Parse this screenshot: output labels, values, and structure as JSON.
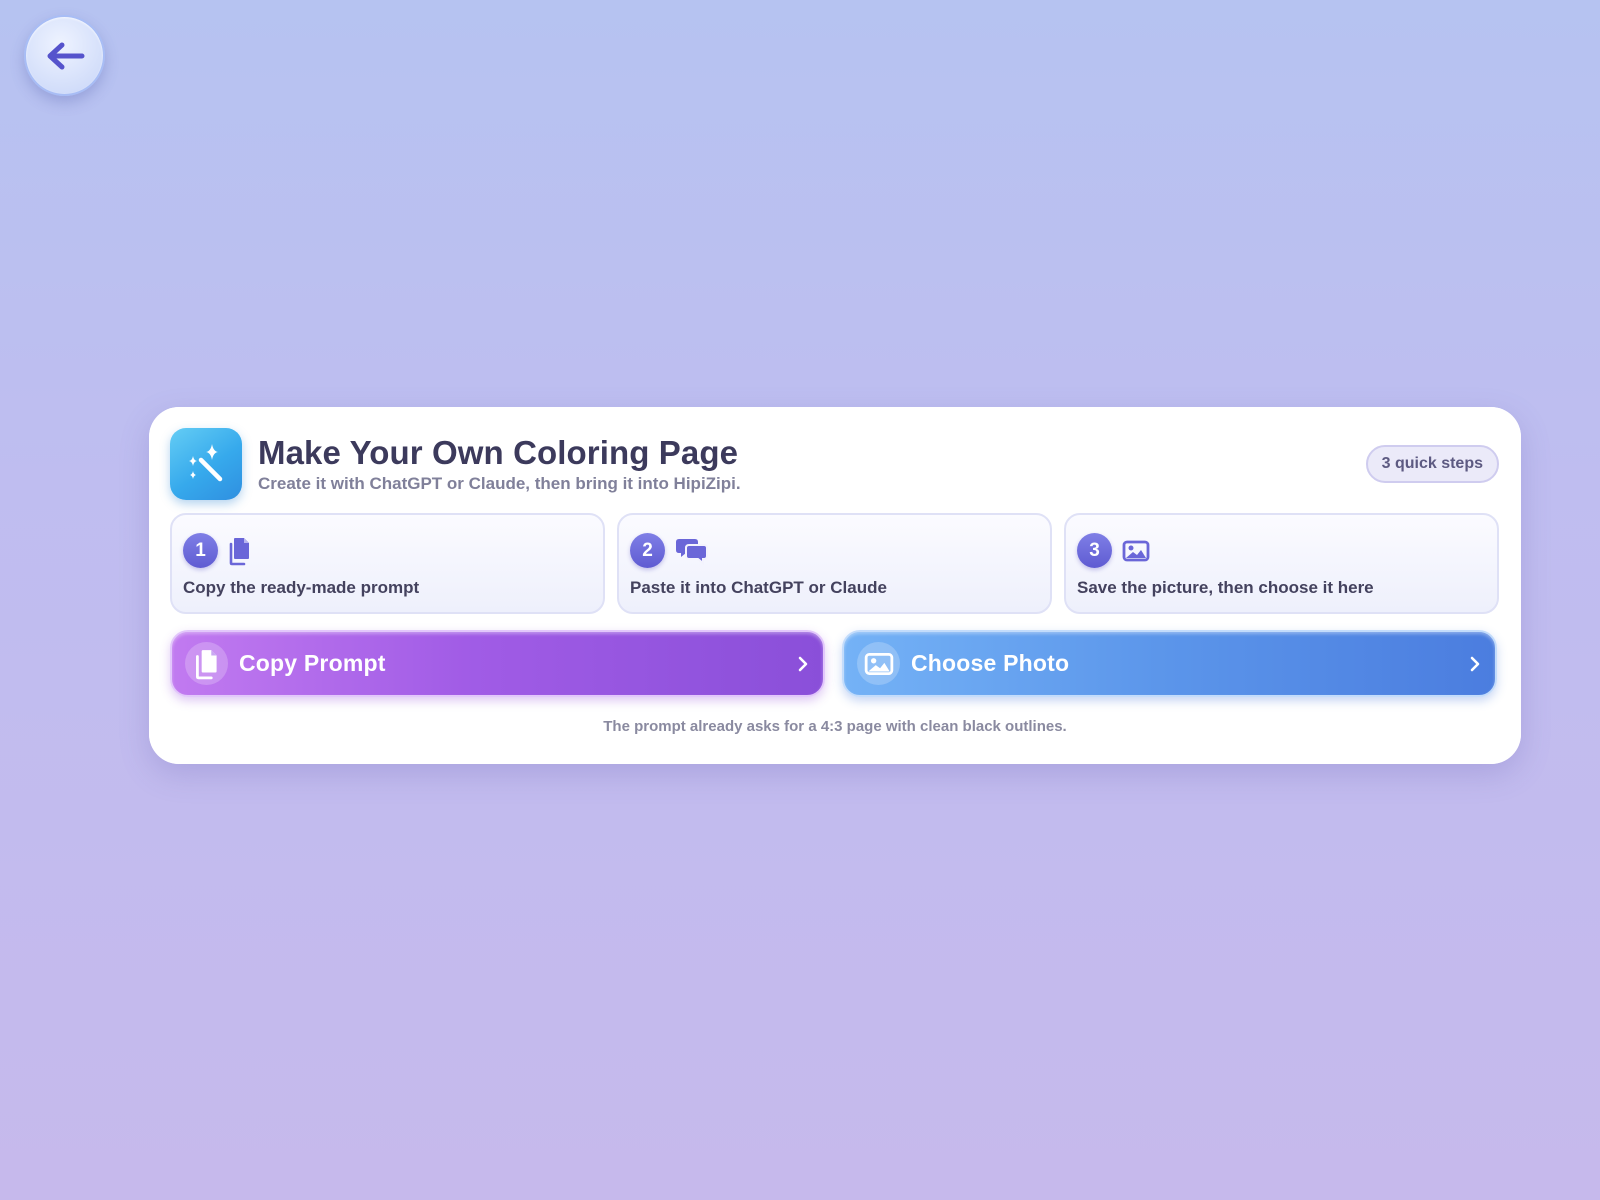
{
  "header": {
    "title": "Make Your Own Coloring Page",
    "subtitle": "Create it with ChatGPT or Claude, then bring it into HipiZipi.",
    "badge": "3 quick steps",
    "app_icon": "magic-wand-sparkles-icon"
  },
  "back_button": {
    "icon": "arrow-left-icon"
  },
  "steps": [
    {
      "number": "1",
      "icon": "copy-document-icon",
      "label": "Copy the ready-made prompt"
    },
    {
      "number": "2",
      "icon": "chat-bubbles-icon",
      "label": "Paste it into ChatGPT or Claude"
    },
    {
      "number": "3",
      "icon": "image-icon",
      "label": "Save the picture, then choose it here"
    }
  ],
  "actions": {
    "copy_prompt": {
      "label": "Copy Prompt",
      "icon": "copy-document-icon"
    },
    "choose_photo": {
      "label": "Choose Photo",
      "icon": "image-icon"
    }
  },
  "footnote": "The prompt already asks for a 4:3 page with clean black outlines.",
  "colors": {
    "accent_indigo": "#5f5bd2",
    "copy_button": "#a15ce6",
    "photo_button": "#5b95ea",
    "app_icon": "#36a9ec"
  }
}
